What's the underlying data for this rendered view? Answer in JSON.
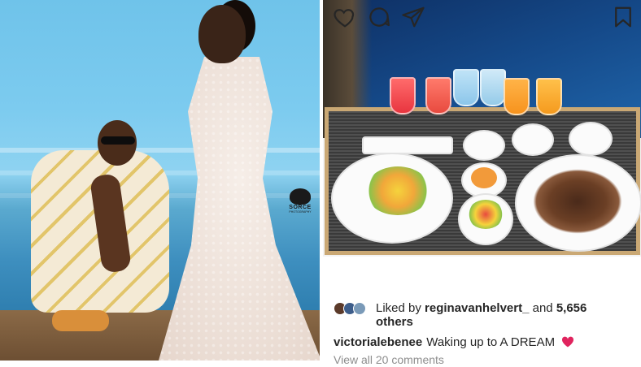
{
  "left_photo": {
    "watermark": {
      "brand": "SORCE",
      "sub": "PHOTOGRAPHY"
    }
  },
  "post": {
    "icons": {
      "like": "heart-icon",
      "comment": "comment-icon",
      "share": "send-icon",
      "save": "bookmark-icon"
    },
    "likes": {
      "prefix": "Liked by",
      "user": "reginavanhelvert_",
      "and": "and",
      "count": "5,656",
      "suffix": "others"
    },
    "caption": {
      "username": "victorialebenee",
      "text": "Waking up to A DREAM",
      "emoji": "red-heart-emoji"
    },
    "view_comments": "View all 20 comments"
  },
  "colors": {
    "text": "#262626",
    "muted": "#8e8e8e",
    "heart": "#e0245e",
    "sky": "#7ccbef",
    "sea": "#154a8a",
    "tray_frame": "#caa874"
  }
}
